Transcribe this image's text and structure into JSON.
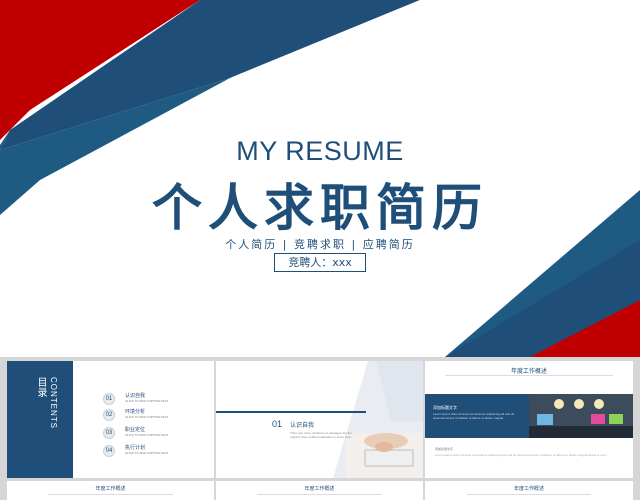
{
  "hero": {
    "title_en": "MY RESUME",
    "title_cn": "个人求职简历",
    "tags": "个人简历 | 竞聘求职 | 应聘简历",
    "applicant": "竞聘人：xxx"
  },
  "colors": {
    "navy": "#1f4e79",
    "red": "#c00000",
    "blue": "#1e5a82"
  },
  "thumb1": {
    "title_cn": "目录",
    "title_en": "CONTENTS",
    "items": [
      {
        "num": "01",
        "title": "认识自我",
        "sub": "CLICK TO ADD CAPTION TEXT"
      },
      {
        "num": "02",
        "title": "环境分析",
        "sub": "CLICK TO ADD CAPTION TEXT"
      },
      {
        "num": "03",
        "title": "职业定位",
        "sub": "CLICK TO ADD CAPTION TEXT"
      },
      {
        "num": "04",
        "title": "执行计划",
        "sub": "CLICK TO ADD CAPTION TEXT"
      }
    ]
  },
  "thumb2": {
    "num": "01",
    "title": "认识自我",
    "text": "There are many variations of passages but the majority have suffered alteration in some form"
  },
  "thumb3": {
    "title": "年度工作概述",
    "band_title": "添加标题文字",
    "band_text": "Lorem ipsum dolor sit amet consectetur adipiscing elit sed do eiusmod tempor incididunt ut labore et dolore magna",
    "sub": "添加标题文字",
    "lines": "Lorem ipsum dolor sit amet consectetur adipiscing elit sed do eiusmod tempor incididunt ut labore et dolore magna aliqua ut enim"
  },
  "thumb4": {
    "title": "年度工作概述"
  },
  "thumb5": {
    "title": "年度工作概述"
  },
  "thumb6": {
    "title": "年度工作概述"
  }
}
